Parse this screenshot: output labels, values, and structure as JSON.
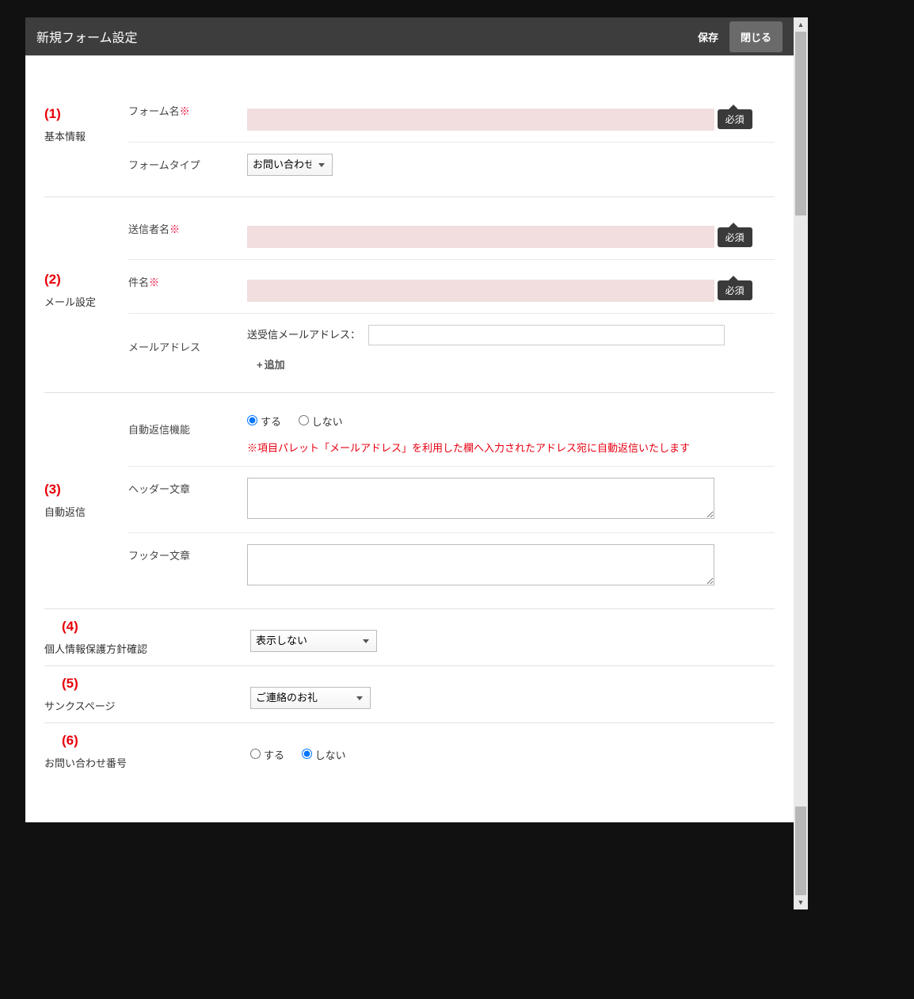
{
  "header": {
    "title": "新規フォーム設定",
    "save": "保存",
    "close": "閉じる"
  },
  "s1": {
    "num": "(1)",
    "title": "基本情報",
    "form_name_label": "フォーム名",
    "req": "※",
    "required_tag": "必須",
    "form_type_label": "フォームタイプ",
    "form_type_value": "お問い合わせ"
  },
  "s2": {
    "num": "(2)",
    "title": "メール設定",
    "sender_label": "送信者名",
    "subject_label": "件名",
    "required_tag": "必須",
    "mail_label": "メールアドレス",
    "send_recv_label": "送受信メールアドレス：",
    "add_label": "追加"
  },
  "s3": {
    "num": "(3)",
    "title": "自動返信",
    "auto_reply_label": "自動返信機能",
    "opt_yes": "する",
    "opt_no": "しない",
    "note": "※項目パレット「メールアドレス」を利用した欄へ入力されたアドレス宛に自動返信いたします",
    "header_text_label": "ヘッダー文章",
    "footer_text_label": "フッター文章"
  },
  "s4": {
    "num": "(4)",
    "title": "個人情報保護方針確認",
    "select_value": "表示しない"
  },
  "s5": {
    "num": "(5)",
    "title": "サンクスページ",
    "select_value": "ご連絡のお礼"
  },
  "s6": {
    "num": "(6)",
    "title": "お問い合わせ番号",
    "opt_yes": "する",
    "opt_no": "しない"
  }
}
